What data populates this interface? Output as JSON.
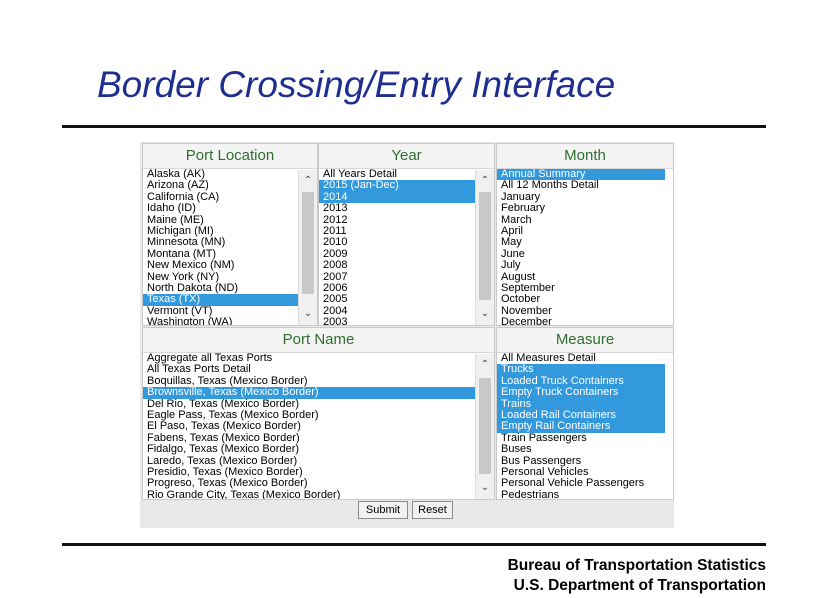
{
  "title": "Border Crossing/Entry Interface",
  "footer": {
    "line1": "Bureau of Transportation Statistics",
    "line2": "U.S. Department of Transportation"
  },
  "panels": {
    "port_location": {
      "header": "Port Location",
      "items": [
        {
          "label": "Alaska (AK)",
          "selected": false
        },
        {
          "label": "Arizona (AZ)",
          "selected": false
        },
        {
          "label": "California (CA)",
          "selected": false
        },
        {
          "label": "Idaho (ID)",
          "selected": false
        },
        {
          "label": "Maine (ME)",
          "selected": false
        },
        {
          "label": "Michigan (MI)",
          "selected": false
        },
        {
          "label": "Minnesota (MN)",
          "selected": false
        },
        {
          "label": "Montana (MT)",
          "selected": false
        },
        {
          "label": "New Mexico (NM)",
          "selected": false
        },
        {
          "label": "New York (NY)",
          "selected": false
        },
        {
          "label": "North Dakota (ND)",
          "selected": false
        },
        {
          "label": "Texas (TX)",
          "selected": true
        },
        {
          "label": "Vermont (VT)",
          "selected": false
        },
        {
          "label": "Washington (WA)",
          "selected": false
        }
      ]
    },
    "year": {
      "header": "Year",
      "items": [
        {
          "label": "All Years Detail",
          "selected": false
        },
        {
          "label": "2015 (Jan-Dec)",
          "selected": true
        },
        {
          "label": "2014",
          "selected": true
        },
        {
          "label": "2013",
          "selected": false
        },
        {
          "label": "2012",
          "selected": false
        },
        {
          "label": "2011",
          "selected": false
        },
        {
          "label": "2010",
          "selected": false
        },
        {
          "label": "2009",
          "selected": false
        },
        {
          "label": "2008",
          "selected": false
        },
        {
          "label": "2007",
          "selected": false
        },
        {
          "label": "2006",
          "selected": false
        },
        {
          "label": "2005",
          "selected": false
        },
        {
          "label": "2004",
          "selected": false
        },
        {
          "label": "2003",
          "selected": false
        }
      ]
    },
    "month": {
      "header": "Month",
      "items": [
        {
          "label": "Annual Summary",
          "selected": true
        },
        {
          "label": "All 12 Months Detail",
          "selected": false
        },
        {
          "label": "January",
          "selected": false
        },
        {
          "label": "February",
          "selected": false
        },
        {
          "label": "March",
          "selected": false
        },
        {
          "label": "April",
          "selected": false
        },
        {
          "label": "May",
          "selected": false
        },
        {
          "label": "June",
          "selected": false
        },
        {
          "label": "July",
          "selected": false
        },
        {
          "label": "August",
          "selected": false
        },
        {
          "label": "September",
          "selected": false
        },
        {
          "label": "October",
          "selected": false
        },
        {
          "label": "November",
          "selected": false
        },
        {
          "label": "December",
          "selected": false
        }
      ]
    },
    "port_name": {
      "header": "Port Name",
      "items": [
        {
          "label": "Aggregate all Texas Ports",
          "selected": false
        },
        {
          "label": "All Texas Ports Detail",
          "selected": false
        },
        {
          "label": "Boquillas, Texas (Mexico Border)",
          "selected": false
        },
        {
          "label": "Brownsville, Texas (Mexico Border)",
          "selected": true
        },
        {
          "label": "Del Rio, Texas (Mexico Border)",
          "selected": false
        },
        {
          "label": "Eagle Pass, Texas (Mexico Border)",
          "selected": false
        },
        {
          "label": "El Paso, Texas (Mexico Border)",
          "selected": false
        },
        {
          "label": "Fabens, Texas (Mexico Border)",
          "selected": false
        },
        {
          "label": "Fidalgo, Texas (Mexico Border)",
          "selected": false
        },
        {
          "label": "Laredo, Texas (Mexico Border)",
          "selected": false
        },
        {
          "label": "Presidio, Texas (Mexico Border)",
          "selected": false
        },
        {
          "label": "Progreso, Texas (Mexico Border)",
          "selected": false
        },
        {
          "label": "Rio Grande City, Texas (Mexico Border)",
          "selected": false
        }
      ]
    },
    "measure": {
      "header": "Measure",
      "items": [
        {
          "label": "All Measures Detail",
          "selected": false
        },
        {
          "label": "Trucks",
          "selected": true
        },
        {
          "label": "Loaded Truck Containers",
          "selected": true
        },
        {
          "label": "Empty Truck Containers",
          "selected": true
        },
        {
          "label": "Trains",
          "selected": true
        },
        {
          "label": "Loaded Rail Containers",
          "selected": true
        },
        {
          "label": "Empty Rail Containers",
          "selected": true
        },
        {
          "label": "Train Passengers",
          "selected": false
        },
        {
          "label": "Buses",
          "selected": false
        },
        {
          "label": "Bus Passengers",
          "selected": false
        },
        {
          "label": "Personal Vehicles",
          "selected": false
        },
        {
          "label": "Personal Vehicle Passengers",
          "selected": false
        },
        {
          "label": "Pedestrians",
          "selected": false
        }
      ]
    }
  },
  "buttons": {
    "submit": "Submit",
    "reset": "Reset"
  },
  "icons": {
    "scroll_up": "chevron-up-icon",
    "scroll_down": "chevron-down-icon"
  },
  "colors": {
    "title": "#1f2f8f",
    "header_text": "#2e6f2e",
    "selection": "#3399dd"
  }
}
